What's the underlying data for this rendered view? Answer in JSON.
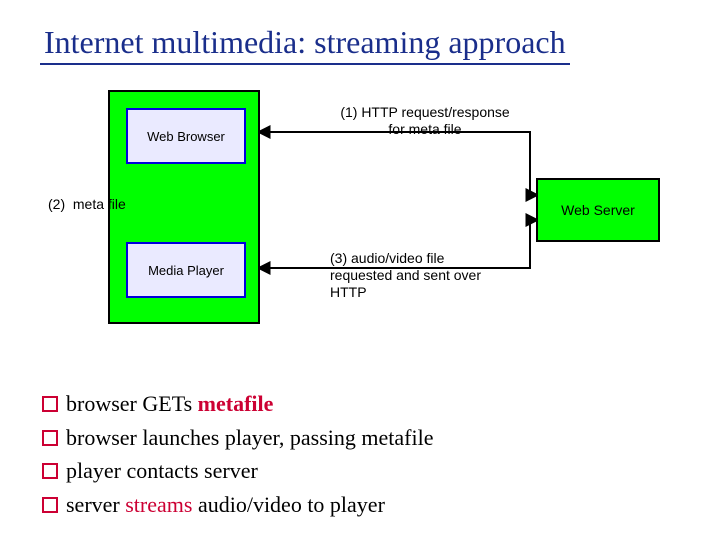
{
  "title": "Internet multimedia: streaming approach",
  "diagram": {
    "client_group": {
      "browser_label": "Web Browser",
      "player_label": "Media\nPlayer"
    },
    "server_label": "Web Server",
    "annotations": {
      "step1": "(1) HTTP request/response\nfor meta file",
      "step2": "(2)  meta file",
      "step3": "(3) audio/video file\nrequested and sent over\nHTTP"
    }
  },
  "bullets": [
    {
      "pre": "browser GETs ",
      "kw": "metafile",
      "post": "",
      "kw_class": "kw-meta"
    },
    {
      "pre": "browser launches player, passing metafile",
      "kw": "",
      "post": ""
    },
    {
      "pre": "player contacts server",
      "kw": "",
      "post": ""
    },
    {
      "pre": "server ",
      "kw": "streams",
      "post": " audio/video to player",
      "kw_class": "kw-stream"
    }
  ]
}
